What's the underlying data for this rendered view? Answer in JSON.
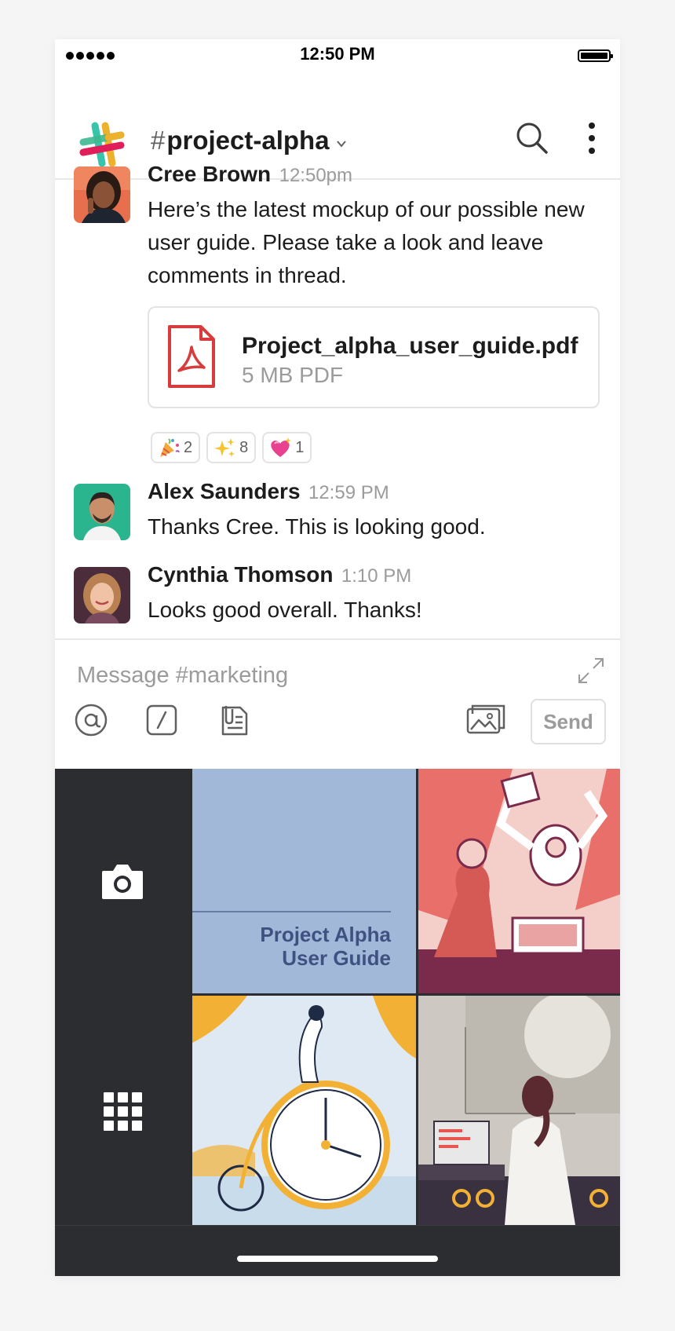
{
  "status_bar": {
    "time": "12:50 PM"
  },
  "header": {
    "hash": "#",
    "channel_name": "project-alpha"
  },
  "messages": [
    {
      "author": "Cree Brown",
      "time": "12:50pm",
      "text": "Here’s the latest mockup of our possible new user guide. Please take a look and leave comments in thread.",
      "attachment": {
        "name": "Project_alpha_user_guide.pdf",
        "meta": "5 MB PDF"
      },
      "reactions": [
        {
          "emoji": "party-popper",
          "count": "2"
        },
        {
          "emoji": "sparkles",
          "count": "8"
        },
        {
          "emoji": "sparkling-heart",
          "count": "1"
        }
      ]
    },
    {
      "author": "Alex Saunders",
      "time": "12:59 PM",
      "text": "Thanks Cree. This is looking good."
    },
    {
      "author": "Cynthia Thomson",
      "time": "1:10 PM",
      "text": "Looks good overall. Thanks!"
    }
  ],
  "composer": {
    "placeholder": "Message #marketing",
    "send_label": "Send"
  },
  "media_picker": {
    "guide_thumbnail": {
      "line1": "Project Alpha",
      "line2": "User Guide"
    }
  },
  "colors": {
    "pdf_red": "#d83b3b",
    "picker_bg": "#2c2d30",
    "guide_bg": "#a2b8d9"
  }
}
